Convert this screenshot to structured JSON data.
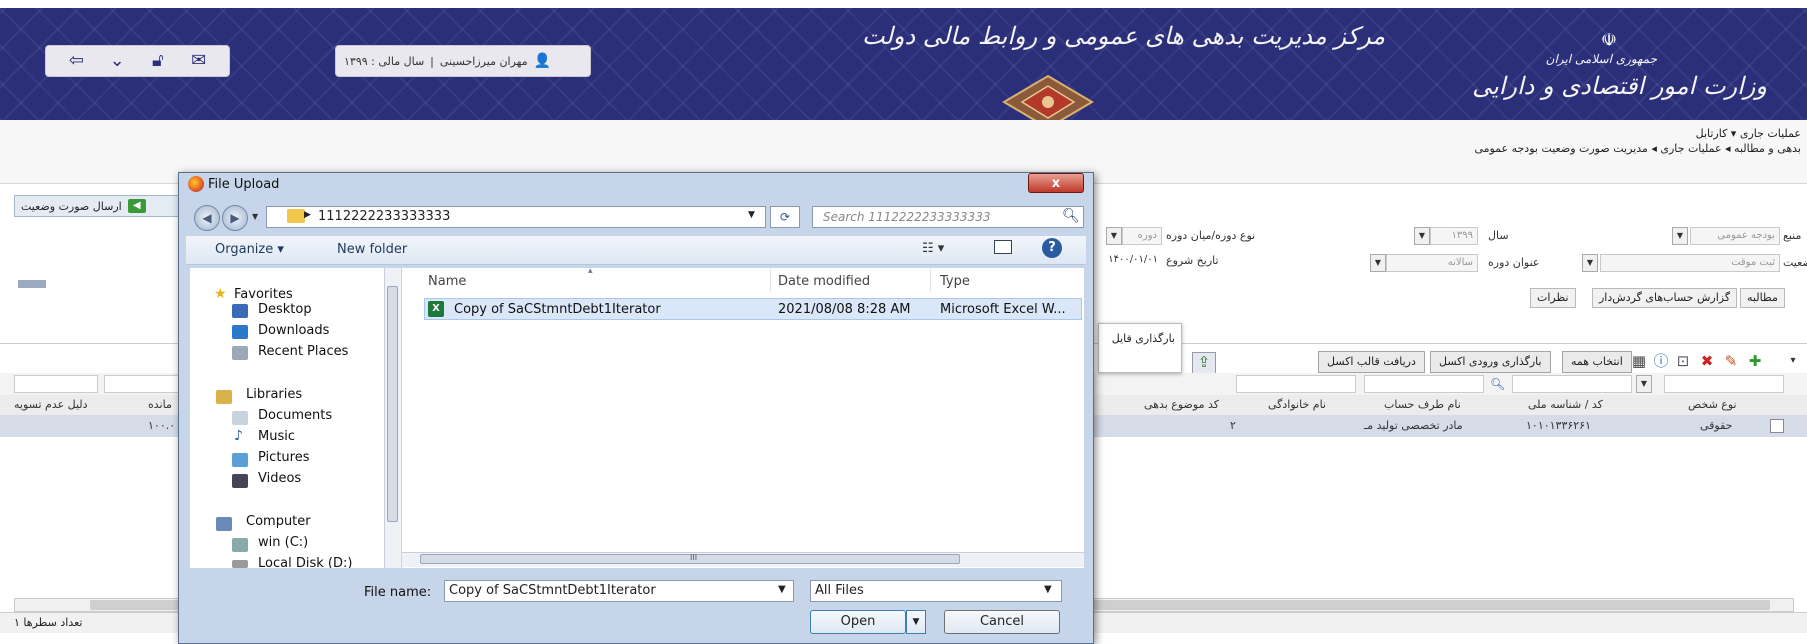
{
  "header": {
    "center_title": "مرکز مدیریت بدهی های عمومی و روابط مالی دولت",
    "right_title": "وزارت امور اقتصادی و دارایی",
    "emblem_text": "جمهوری اسلامی ایران",
    "user_name": "مهران میرزاحسینی",
    "fiscal_year": "سال مالی : ۱۳۹۹",
    "separator": "|",
    "icons": [
      "logout-icon",
      "dropdown-icon",
      "lock-icon",
      "mail-icon"
    ],
    "brand_color": "#2b2f7a"
  },
  "breadcrumb": {
    "line1": "عملیات جاری ▾ کارتابل",
    "line2": "بدهی و مطالبه ◂ عملیات جاری ◂ مدیریت صورت وضعیت بودجه عمومی"
  },
  "filters": {
    "period_type_label": "نوع دوره/میان دوره",
    "period_type_value": "دوره",
    "year_label": "سال",
    "year_value": "۱۳۹۹",
    "source_label": "منبع",
    "source_value": "بودجه عمومی",
    "start_date_label": "تاریخ شروع",
    "start_date_value": "۱۴۰۰/۰۱/۰۱",
    "period_title_label": "عنوان دوره",
    "period_title_value": "سالانه",
    "status_label": "وضعیت",
    "status_value": "ثبت موقت",
    "send_button": "ارسال صورت وضعیت"
  },
  "tabs": [
    "مطالبه",
    "گزارش حساب‌های گردش‌دار",
    "نظرات"
  ],
  "toolbar": {
    "select_all": "انتخاب همه",
    "upload_excel_input": "بارگذاری ورودی اکسل",
    "download_excel_template": "دریافت قالب اکسل",
    "upload_file_hint": "بارگذاری فایل"
  },
  "table": {
    "columns": [
      "نوع شخص",
      "کد / شناسه ملی",
      "نام طرف حساب",
      "نام خانوادگی",
      "کد موضوع بدهی",
      "مانده",
      "دلیل عدم تسویه"
    ],
    "row": {
      "person_type": "حقوقی",
      "national_id": "۱۰۱۰۱۳۳۶۲۶۱",
      "party_name": "مادر تخصصی تولید مـ",
      "subject_code": "۲",
      "balance": "۱۰۰.۰"
    },
    "row_count_label": "تعداد سطرها ۱"
  },
  "dialog": {
    "title": "File Upload",
    "close_label": "x",
    "path": "1112222233333333",
    "search_placeholder": "Search 1112222233333333",
    "organize_label": "Organize ▾",
    "new_folder_label": "New folder",
    "nav": {
      "favorites": "Favorites",
      "fav_items": [
        "Desktop",
        "Downloads",
        "Recent Places"
      ],
      "libraries": "Libraries",
      "lib_items": [
        "Documents",
        "Music",
        "Pictures",
        "Videos"
      ],
      "computer": "Computer",
      "drives": [
        "win (C:)",
        "Local Disk (D:)"
      ]
    },
    "columns": {
      "name": "Name",
      "date_modified": "Date modified",
      "type": "Type"
    },
    "file": {
      "name": "Copy of SaCStmntDebt1Iterator",
      "date": "2021/08/08 8:28 AM",
      "type": "Microsoft Excel W..."
    },
    "file_name_label": "File name:",
    "file_name_value": "Copy of SaCStmntDebt1Iterator",
    "file_type_value": "All Files",
    "open_label": "Open",
    "cancel_label": "Cancel",
    "scroll_marker": "III"
  }
}
